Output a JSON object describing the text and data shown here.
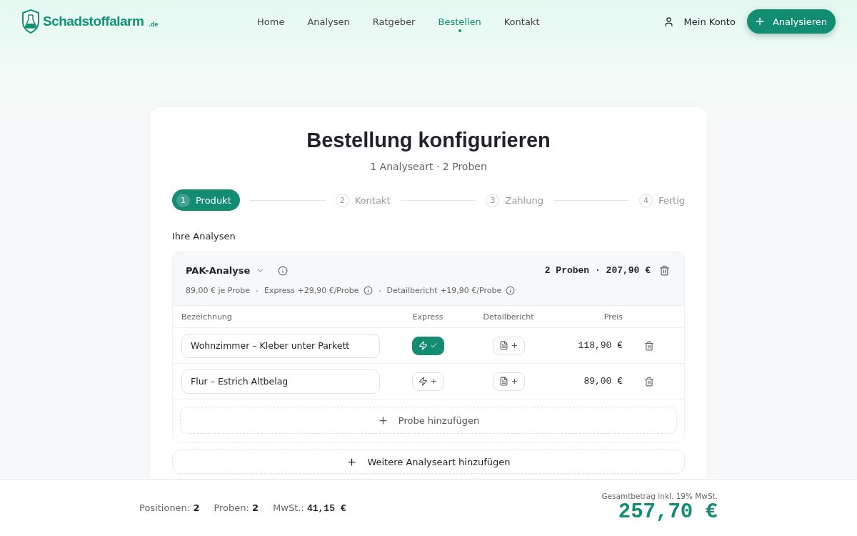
{
  "header": {
    "logo": {
      "name": "Schadstoffalarm",
      "suffix": ".de"
    },
    "nav": [
      {
        "label": "Home",
        "selected": false
      },
      {
        "label": "Analysen",
        "selected": false
      },
      {
        "label": "Ratgeber",
        "selected": false
      },
      {
        "label": "Bestellen",
        "selected": true
      },
      {
        "label": "Kontakt",
        "selected": false
      }
    ],
    "account": "Mein Konto",
    "cta": "Analysieren"
  },
  "title": "Bestellung konfigurieren",
  "subtitle": "1 Analyseart · 2 Proben",
  "steps": [
    {
      "number": "1",
      "label": "Produkt",
      "selected": true
    },
    {
      "number": "2",
      "label": "Kontakt",
      "selected": false
    },
    {
      "number": "3",
      "label": "Zahlung",
      "selected": false
    },
    {
      "number": "4",
      "label": "Fertig",
      "selected": false
    }
  ],
  "section_title": "Ihre Analysen",
  "analysis": {
    "name": "PAK-Analyse",
    "summary": "2 Proben · 207,90 €",
    "price_per_sample": "89,00 € je Probe",
    "express_price": "Express +29,90 €/Probe",
    "report_price": "Detailbericht +19,90 €/Probe",
    "columns": [
      "Bezeichnung",
      "Express",
      "Detailbericht",
      "Preis"
    ],
    "samples": [
      {
        "name": "Wohnzimmer – Kleber unter Parkett",
        "express": true,
        "report": false,
        "price": "118,90 €"
      },
      {
        "name": "Flur – Estrich Altbelag",
        "express": false,
        "report": false,
        "price": "89,00 €"
      }
    ],
    "add_sample": "Probe hinzufügen"
  },
  "add_analysis": "Weitere Analyseart hinzufügen",
  "footer": {
    "stats": [
      {
        "label": "Positionen:",
        "value": "2",
        "kind": "count"
      },
      {
        "label": "Proben:",
        "value": "2",
        "kind": "count"
      },
      {
        "label": "MwSt.:",
        "value": "41,15 €",
        "kind": "money"
      }
    ],
    "total_label": "Gesamtbetrag inkl. 19% MwSt.",
    "total": "257,70 €"
  }
}
